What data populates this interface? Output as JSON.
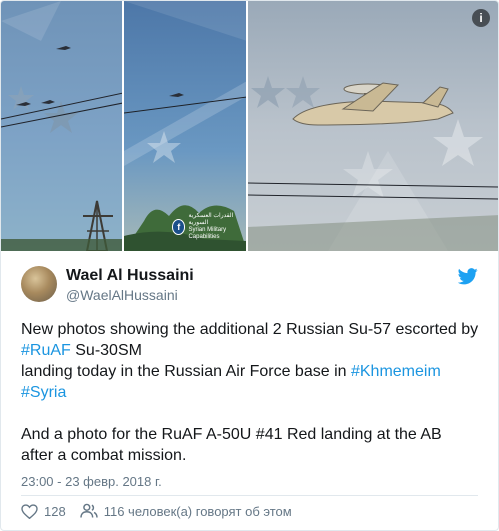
{
  "media": {
    "watermark_line1": "القدرات العسكرية السورية",
    "watermark_line2": "Syrian Military Capabilities",
    "watermark_badge": "f"
  },
  "info_button": "i",
  "author": {
    "display_name": "Wael Al Hussaini",
    "handle": "@WaelAlHussaini"
  },
  "tweet": {
    "l1": "New photos showing the additional 2 Russian Su-57 escorted by",
    "l2_link": "#RuAF",
    "l2_text": " Su-30SM",
    "l3_text": "landing today in the Russian Air Force base in ",
    "l3_link": "#Khmemeim",
    "l4_link": "#Syria",
    "l6": "And a photo for the RuAF A-50U #41 Red landing at the AB",
    "l7": "after a combat mission."
  },
  "timestamp": "23:00 - 23 февр. 2018 г.",
  "actions": {
    "likes": "128",
    "people_talking": "116 человек(а) говорят об этом"
  },
  "colors": {
    "link": "#1b95e0",
    "twitter_blue": "#1da1f2",
    "text": "#14171a",
    "muted": "#657786"
  }
}
